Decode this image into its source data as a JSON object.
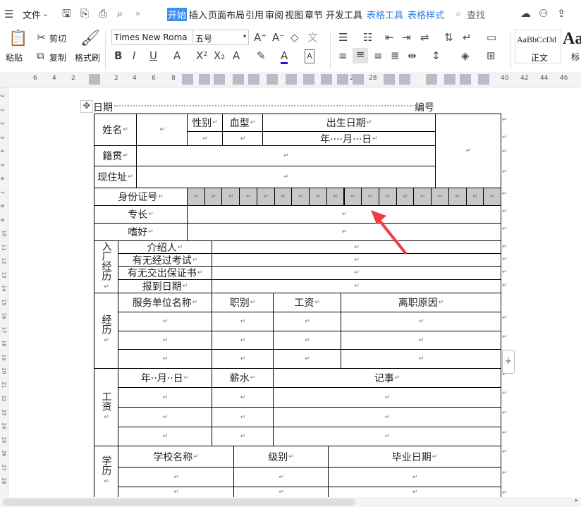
{
  "menubar": {
    "file": "文件",
    "tabs": [
      "开始",
      "插入",
      "页面布局",
      "引用",
      "审阅",
      "视图",
      "章节",
      "开发工具"
    ],
    "context_tabs": [
      "表格工具",
      "表格样式"
    ],
    "search": "查找"
  },
  "ribbon": {
    "paste": "粘贴",
    "cut": "剪切",
    "copy": "复制",
    "format_painter": "格式刷",
    "font_name": "Times New Roma",
    "font_size": "五号",
    "style_preview": "AaBbCcDd",
    "style_normal": "正文",
    "style_heading_preview": "Aa",
    "style_heading": "标"
  },
  "ruler": {
    "numbers": [
      "6",
      "4",
      "2",
      "2",
      "4",
      "6",
      "8",
      "26",
      "28",
      "40",
      "42",
      "44",
      "46"
    ]
  },
  "vruler": {
    "numbers": [
      "2",
      "1",
      "2",
      "3",
      "4",
      "5",
      "6",
      "7",
      "8",
      "9",
      "10",
      "11",
      "12",
      "13",
      "14",
      "15",
      "16",
      "17",
      "18",
      "19",
      "20",
      "21",
      "22",
      "23",
      "24",
      "25",
      "26",
      "27",
      "28"
    ]
  },
  "doc": {
    "date_label": "日期",
    "number_label": "编号",
    "name": "姓名",
    "gender": "性别",
    "blood": "血型",
    "birth": "出生日期",
    "birth_fmt": "年····月···日",
    "native": "籍贯",
    "address": "现住址",
    "id": "身份证号",
    "specialty": "专长",
    "hobby": "嗜好",
    "entry": "入厂经历",
    "introducer": "介绍人",
    "exam": "有无经过考试",
    "guarantee": "有无交出保证书",
    "report_date": "报到日期",
    "experience": "经历",
    "employer": "服务单位名称",
    "position": "职别",
    "wage": "工资",
    "leave_reason": "离职原因",
    "salary_section": "工资",
    "ymd": "年··月··日",
    "pay": "薪水",
    "notes": "记事",
    "education": "学历",
    "school": "学校名称",
    "level": "级别",
    "grad_date": "毕业日期"
  },
  "colors": {
    "accent": "#3c8ef0",
    "annotation_arrow": "#f03c3c"
  }
}
